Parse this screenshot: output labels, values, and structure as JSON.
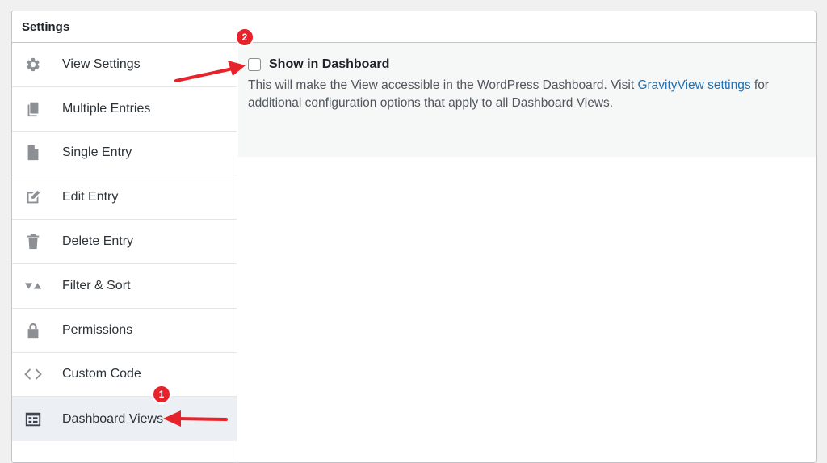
{
  "panel": {
    "title": "Settings"
  },
  "sidebar": {
    "items": [
      {
        "label": "View Settings",
        "icon": "gear-icon"
      },
      {
        "label": "Multiple Entries",
        "icon": "copy-icon"
      },
      {
        "label": "Single Entry",
        "icon": "document-icon"
      },
      {
        "label": "Edit Entry",
        "icon": "edit-icon"
      },
      {
        "label": "Delete Entry",
        "icon": "trash-icon"
      },
      {
        "label": "Filter & Sort",
        "icon": "filter-sort-icon"
      },
      {
        "label": "Permissions",
        "icon": "lock-icon"
      },
      {
        "label": "Custom Code",
        "icon": "code-icon"
      },
      {
        "label": "Dashboard Views",
        "icon": "dashboard-grid-icon",
        "active": true
      }
    ]
  },
  "content": {
    "option_label": "Show in Dashboard",
    "option_checked": false,
    "desc_before": "This will make the View accessible in the WordPress Dashboard. Visit ",
    "desc_link": "GravityView settings",
    "desc_after": " for additional configuration options that apply to all Dashboard Views."
  },
  "annotations": {
    "badge_1": "1",
    "badge_2": "2",
    "badge_color": "#e8222a"
  },
  "colors": {
    "link": "#2271b1",
    "active_bg": "#eceff4",
    "content_bg": "#f6f7f7"
  }
}
